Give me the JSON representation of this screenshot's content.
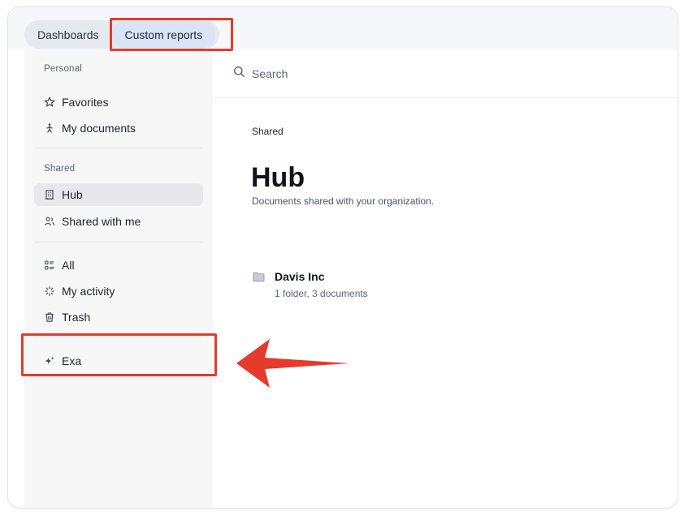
{
  "tabs": [
    {
      "label": "Dashboards",
      "active": false
    },
    {
      "label": "Custom reports",
      "active": true
    }
  ],
  "sidebar": {
    "personal_label": "Personal",
    "personal_items": [
      {
        "label": "Favorites",
        "icon": "star-icon"
      },
      {
        "label": "My documents",
        "icon": "person-walking-icon"
      }
    ],
    "shared_label": "Shared",
    "shared_items": [
      {
        "label": "Hub",
        "icon": "building-icon",
        "active": true
      },
      {
        "label": "Shared with me",
        "icon": "users-icon"
      }
    ],
    "other_items": [
      {
        "label": "All",
        "icon": "list-icon"
      },
      {
        "label": "My activity",
        "icon": "sparkle-burst-icon"
      },
      {
        "label": "Trash",
        "icon": "trash-icon"
      }
    ],
    "exa_item": {
      "label": "Exa",
      "icon": "sparkles-icon"
    }
  },
  "search": {
    "placeholder": "Search"
  },
  "main": {
    "breadcrumb": "Shared",
    "title": "Hub",
    "subtitle": "Documents shared with your organization.",
    "folders": [
      {
        "name": "Davis Inc",
        "meta": "1 folder, 3 documents"
      }
    ]
  },
  "colors": {
    "highlight": "#e53b2c",
    "active_tab": "#d9e5f6",
    "sidebar_bg": "#f7f7f8",
    "active_item": "#e8e8ea"
  }
}
